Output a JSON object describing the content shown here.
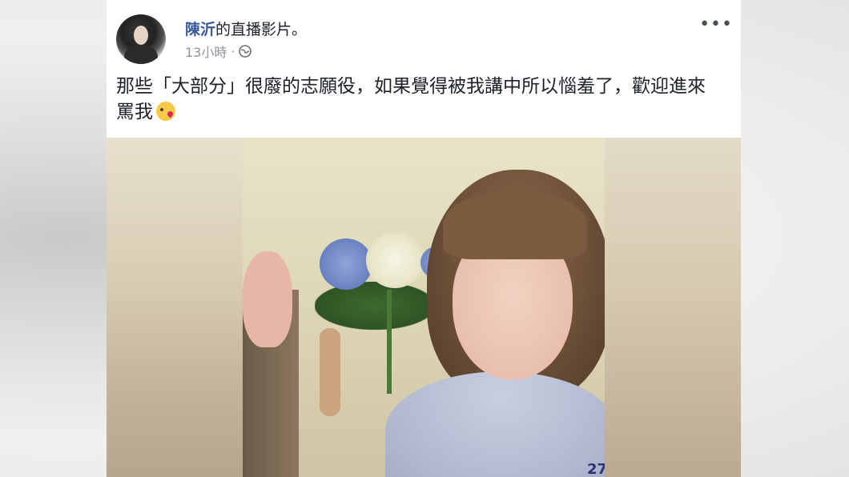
{
  "post": {
    "author": "陳沂",
    "title_suffix": "的直播影片。",
    "timestamp": "13小時",
    "meta_separator": "·",
    "privacy_icon": "globe-icon",
    "more_label": "•••",
    "caption_line1": "那些「大部分」很廢的志願役，如果覺得被我講中所以惱羞了，歡迎進來",
    "caption_line2": "罵我",
    "emoji": "kissing-face-icon"
  },
  "video": {
    "shirt_text": "27"
  },
  "colors": {
    "author_link": "#365899",
    "text": "#1d2129",
    "meta": "#8f949b"
  }
}
